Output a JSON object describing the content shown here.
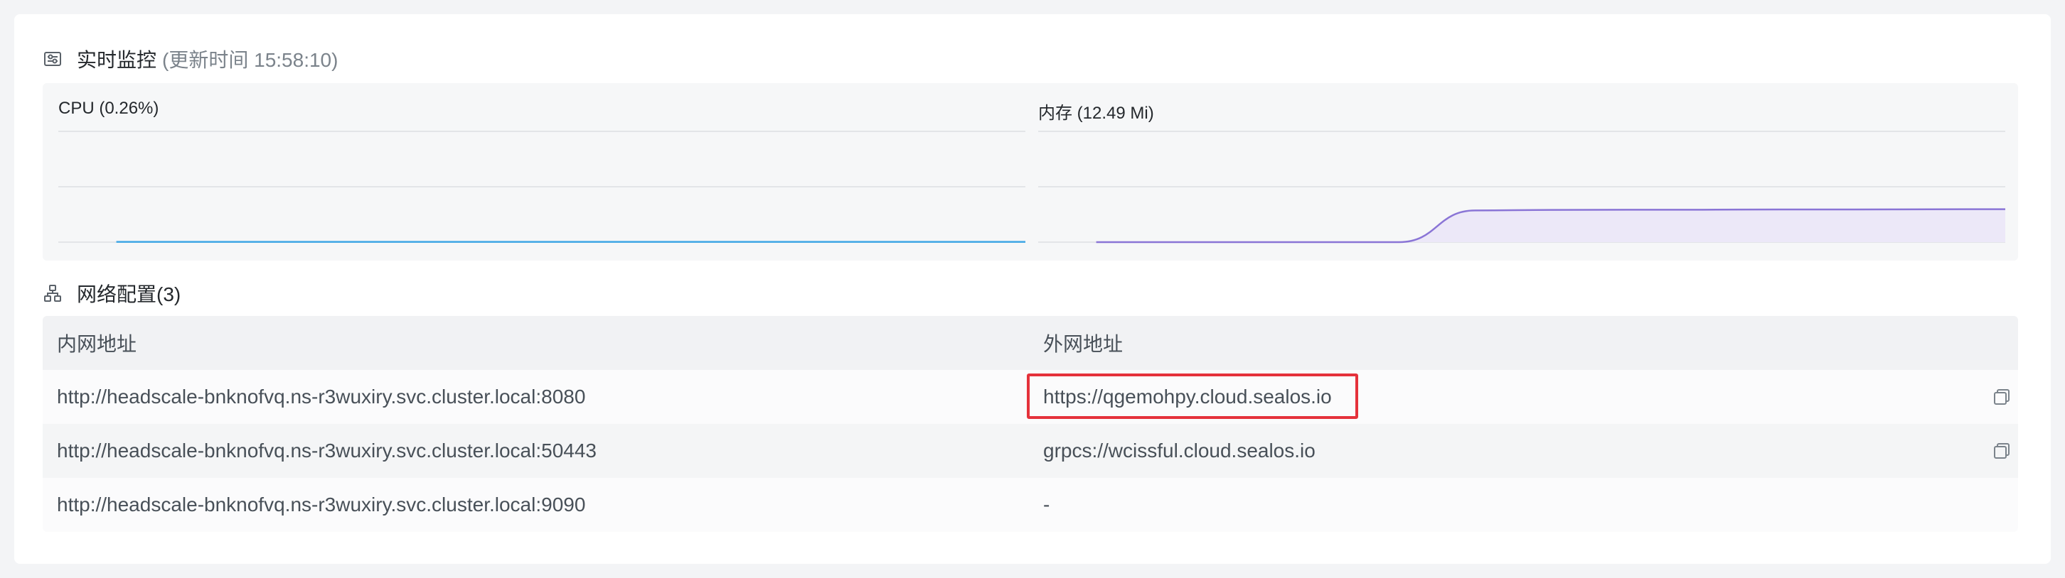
{
  "monitor": {
    "title": "实时监控",
    "updated": "(更新时间  15:58:10)",
    "icon": "monitor-settings-icon"
  },
  "charts": {
    "cpu": {
      "label": "CPU  (0.26%)",
      "color": "#3ea6e6"
    },
    "memory": {
      "label": "内存  (12.49 Mi)",
      "color": "#8a75d6",
      "fill": "#ece8f8"
    }
  },
  "chart_data": [
    {
      "type": "line",
      "title": "CPU  (0.26%)",
      "xlabel": "",
      "ylabel": "",
      "grid": true,
      "series": [
        {
          "values": [
            0.26,
            0.26,
            0.26,
            0.26,
            0.26,
            0.26,
            0.26,
            0.26,
            0.26,
            0.26,
            0.27,
            0.26,
            0.26
          ]
        }
      ]
    },
    {
      "type": "area",
      "title": "内存  (12.49 Mi)",
      "xlabel": "",
      "ylabel": "",
      "grid": true,
      "series": [
        {
          "values": [
            0,
            0,
            0,
            0,
            0,
            12.0,
            12.2,
            12.3,
            12.3,
            12.4,
            12.4,
            12.45,
            12.49
          ]
        }
      ]
    }
  ],
  "network": {
    "title": "网络配置(3)",
    "icon": "network-icon",
    "headers": {
      "internal": "内网地址",
      "external": "外网地址"
    },
    "rows": [
      {
        "internal": "http://headscale-bnknofvq.ns-r3wuxiry.svc.cluster.local:8080",
        "external": "https://qgemohpy.cloud.sealos.io",
        "copy": true,
        "highlighted": true
      },
      {
        "internal": "http://headscale-bnknofvq.ns-r3wuxiry.svc.cluster.local:50443",
        "external": "grpcs://wcissful.cloud.sealos.io",
        "copy": true,
        "highlighted": false
      },
      {
        "internal": "http://headscale-bnknofvq.ns-r3wuxiry.svc.cluster.local:9090",
        "external": "-",
        "copy": false,
        "highlighted": false
      }
    ]
  }
}
